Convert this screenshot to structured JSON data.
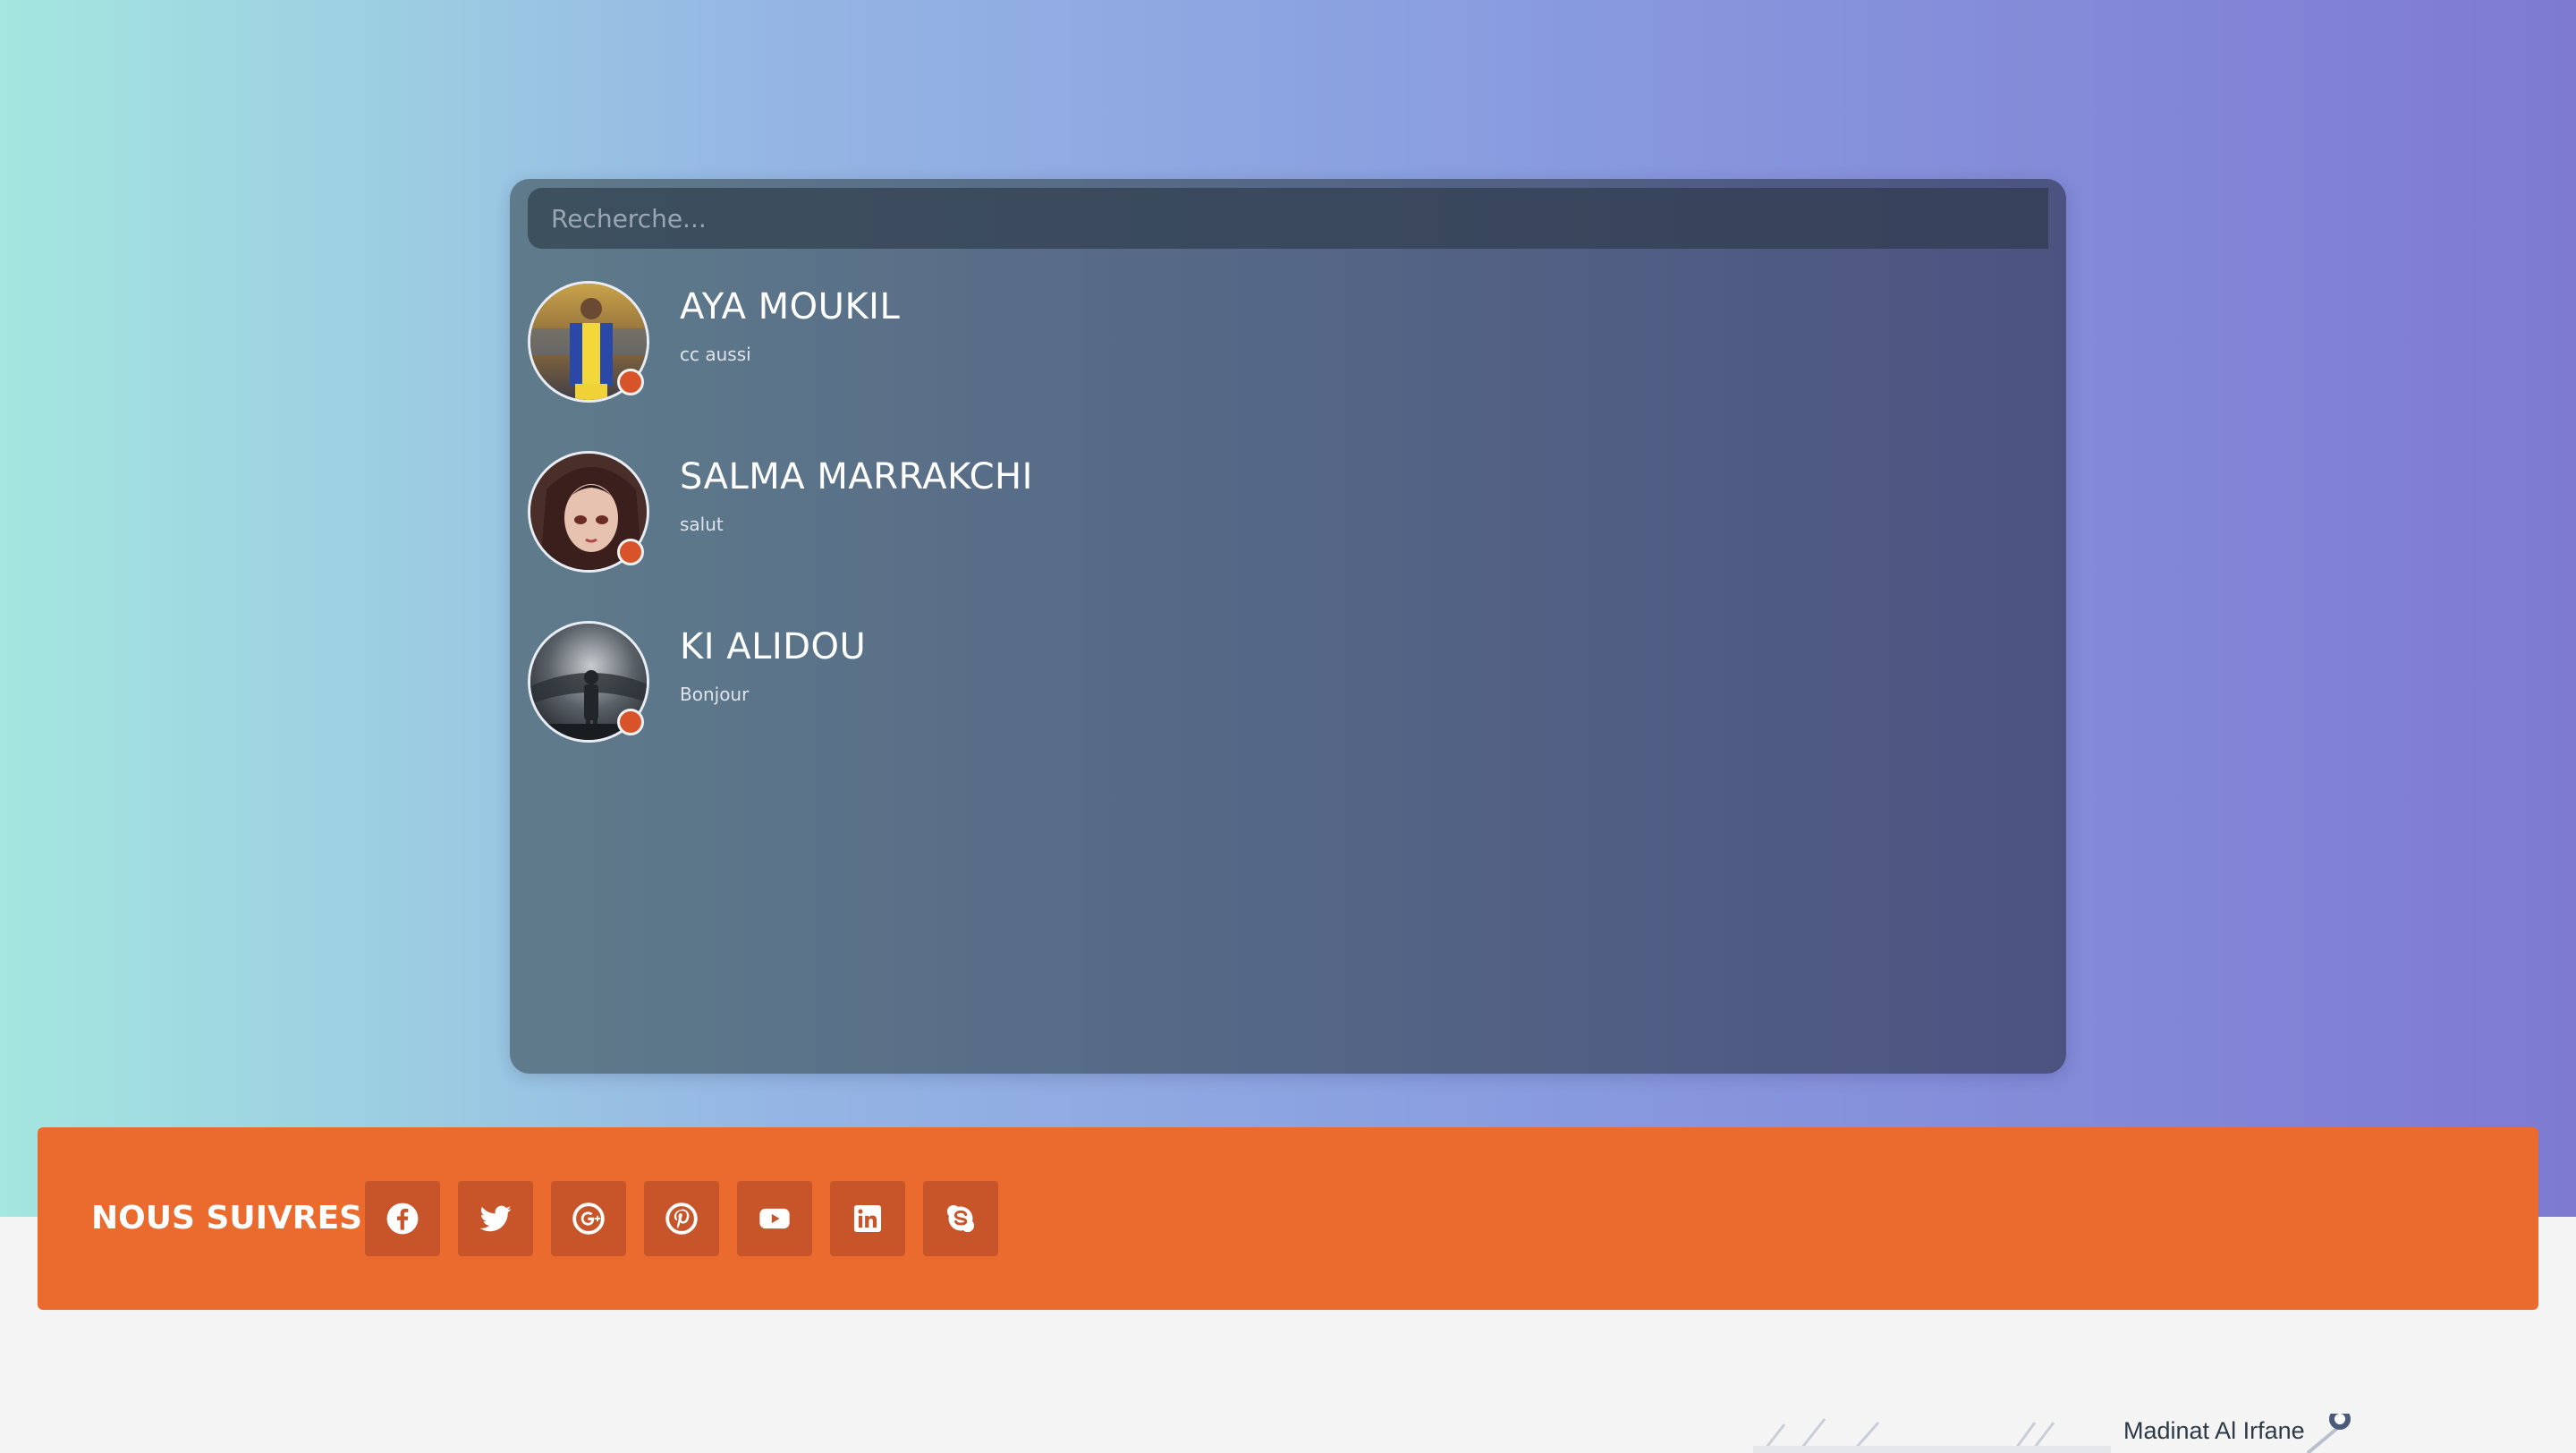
{
  "search": {
    "placeholder": "Recherche..."
  },
  "contacts": [
    {
      "name": "AYA MOUKIL",
      "message": "cc aussi",
      "status_color": "#d9532a"
    },
    {
      "name": "SALMA MARRAKCHI",
      "message": "salut",
      "status_color": "#d9532a"
    },
    {
      "name": "KI ALIDOU",
      "message": "Bonjour",
      "status_color": "#d9532a"
    }
  ],
  "footer": {
    "follow_label": "NOUS SUIVRES",
    "socials": [
      "facebook-icon",
      "twitter-icon",
      "google-plus-icon",
      "pinterest-icon",
      "youtube-icon",
      "linkedin-icon",
      "skype-icon"
    ]
  },
  "map": {
    "label": "Madinat Al Irfane"
  },
  "colors": {
    "accent_orange": "#eb6a2d",
    "social_button": "#c8552a",
    "status_dot": "#d9532a"
  }
}
